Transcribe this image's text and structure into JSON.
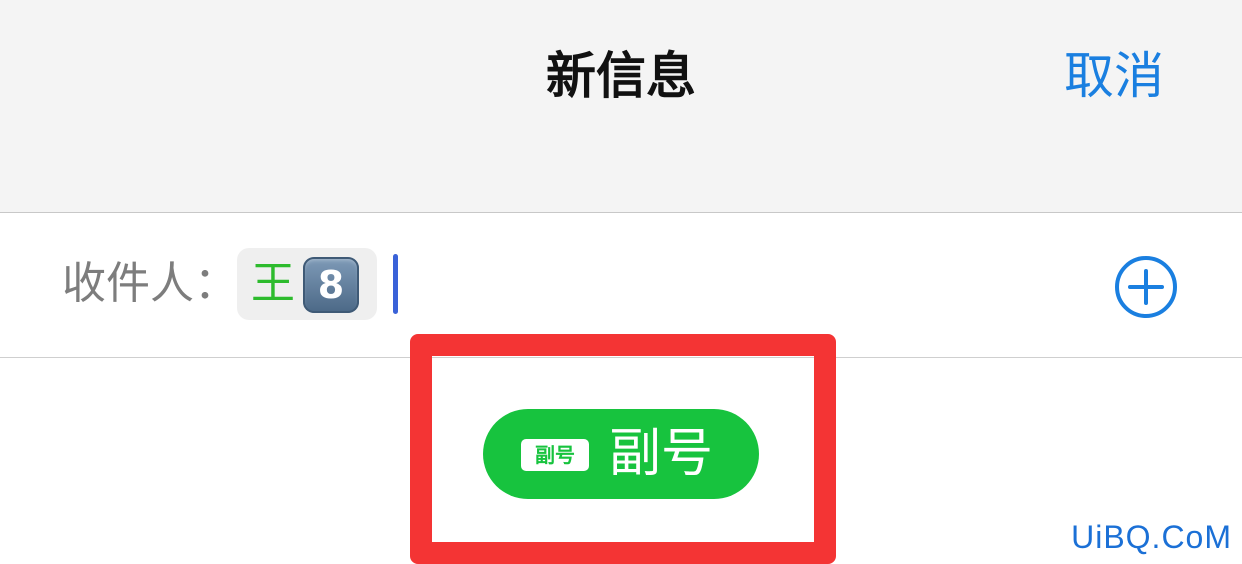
{
  "header": {
    "title": "新信息",
    "cancel_label": "取消"
  },
  "recipient": {
    "label": "收件人：",
    "chip": {
      "name": "王",
      "emoji_digit": "8"
    },
    "add_icon": "plus-circle-icon"
  },
  "badge": {
    "tag_text": "副号",
    "text": "副号"
  },
  "watermark": {
    "text": "UiBQ.CoM"
  },
  "colors": {
    "accent_blue": "#1a7fe0",
    "highlight_red": "#f43434",
    "badge_green": "#17c33e",
    "chip_name_green": "#2dbb2d",
    "caret_blue": "#3a62d8"
  }
}
